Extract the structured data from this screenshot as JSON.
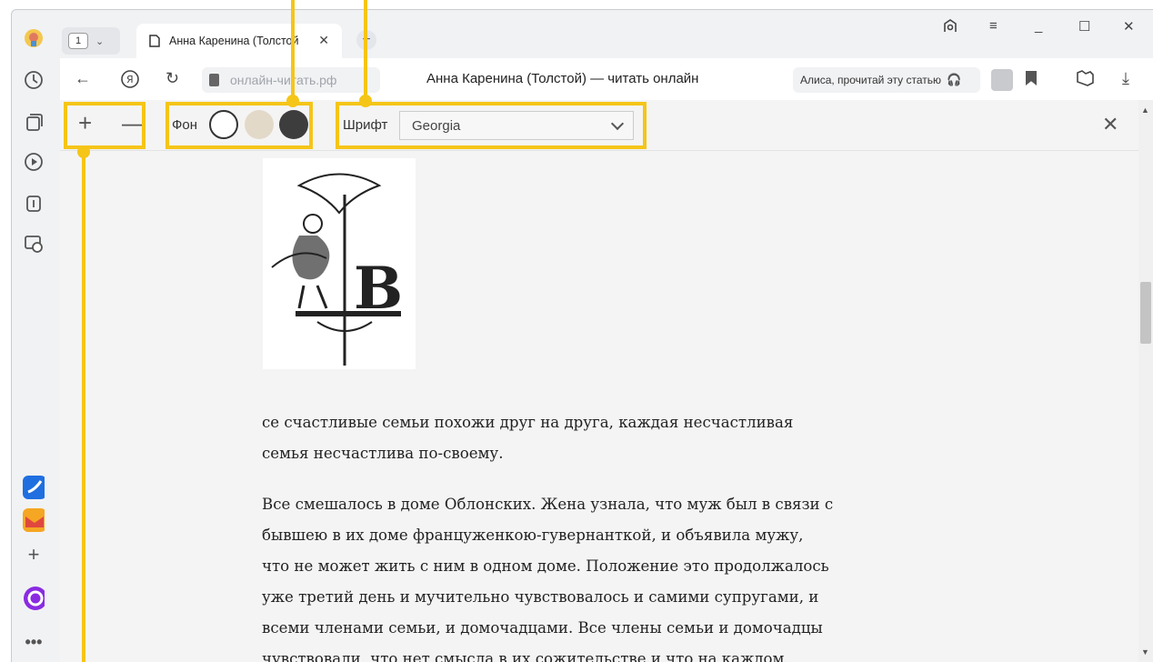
{
  "tab": {
    "count": "1",
    "title": "Анна Каренина (Толстой"
  },
  "address": {
    "url": "онлайн-читать.рф",
    "page_title": "Анна Каренина (Толстой) — читать онлайн",
    "alisa": "Алиса, прочитай эту статью"
  },
  "reader": {
    "background_label": "Фон",
    "font_label": "Шрифт",
    "font_value": "Georgia"
  },
  "colors": {
    "highlight": "#f5c518",
    "bg_white": "#ffffff",
    "bg_sepia": "#e3d9c9",
    "bg_dark": "#3d3d3d"
  },
  "content": {
    "p1_line1": "се счастливые семьи похожи друг на друга, каждая несчастливая",
    "p1_line2": "семья несчастлива по-своему.",
    "p2_line1": "Все смешалось в доме Облонских. Жена узнала, что муж был в связи с",
    "p2_line2": "бывшею в их доме француженкою-гувернанткой, и объявила мужу,",
    "p2_line3": "что не может жить с ним в одном доме. Положение это продолжалось",
    "p2_line4": "уже третий день и мучительно чувствовалось и самими супругами, и",
    "p2_line5": "всеми членами семьи, и домочадцами. Все члены семьи и домочадцы",
    "p2_line6": "чувствовали, что нет смысла в их сожительстве и что на каждом"
  },
  "illustration": {
    "letter": "В"
  }
}
